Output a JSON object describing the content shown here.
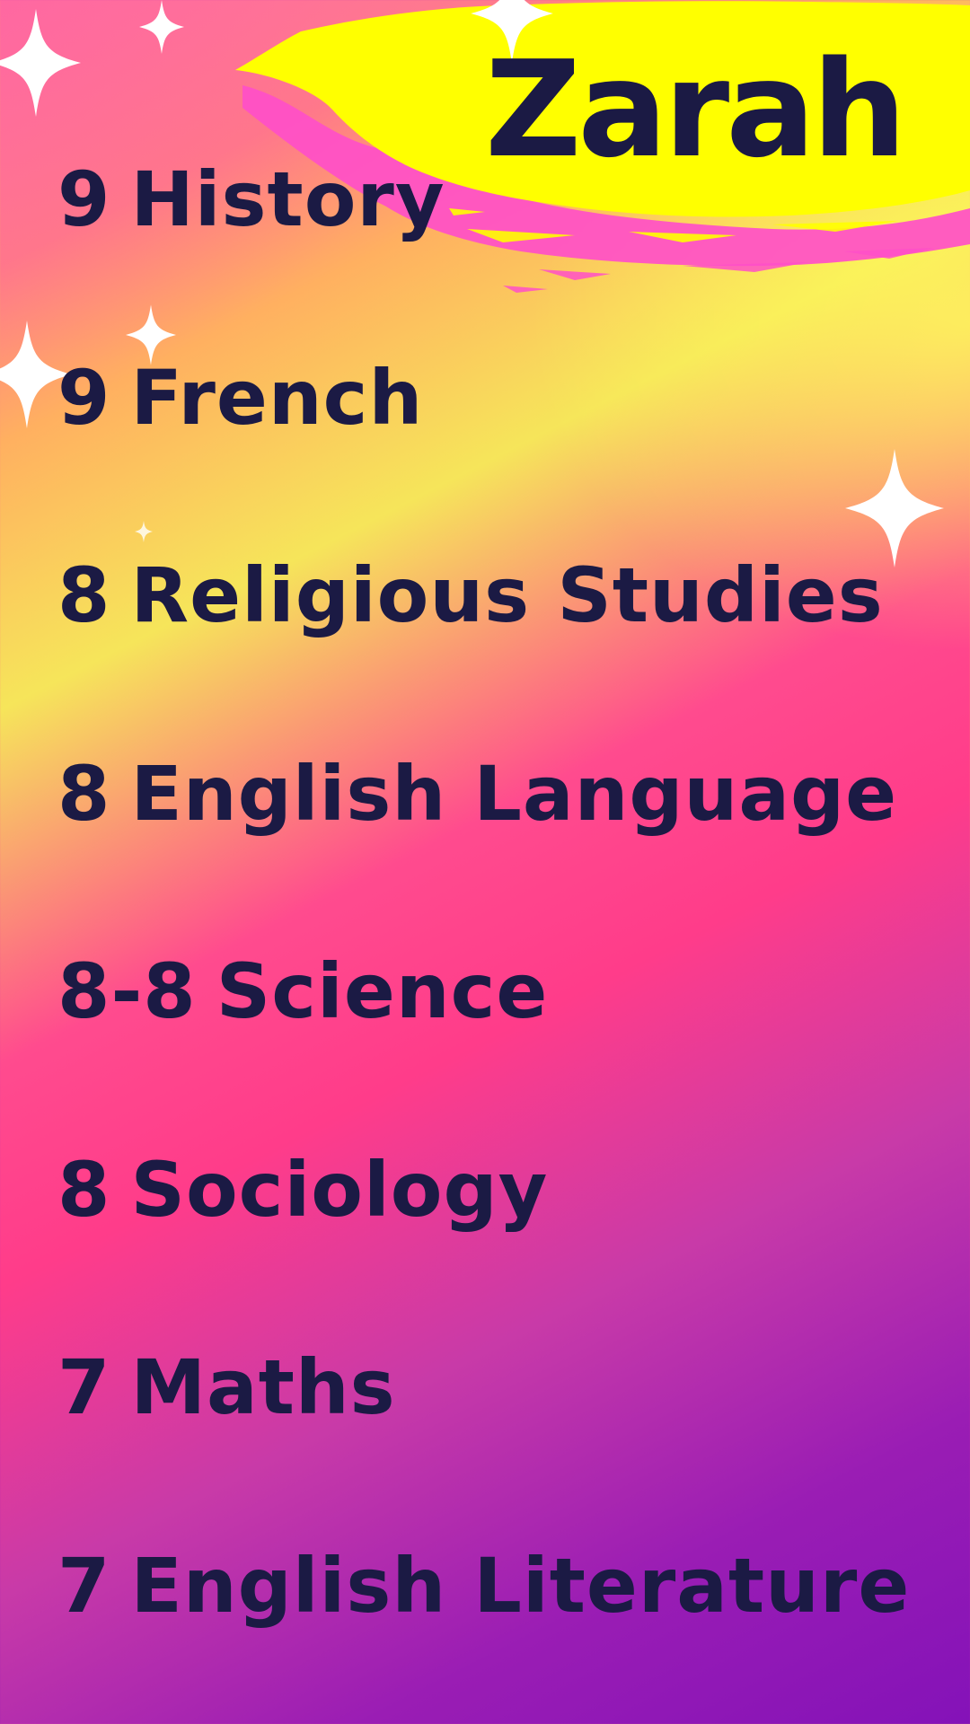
{
  "name": "Zarah",
  "grades": [
    {
      "grade": "9",
      "subject": "History"
    },
    {
      "grade": "9",
      "subject": "French"
    },
    {
      "grade": "8",
      "subject": "Religious Studies"
    },
    {
      "grade": "8",
      "subject": "English Language"
    },
    {
      "grade": "8-8",
      "subject": "Science"
    },
    {
      "grade": "8",
      "subject": "Sociology"
    },
    {
      "grade": "7",
      "subject": "Maths"
    },
    {
      "grade": "7",
      "subject": "English Literature"
    }
  ],
  "colors": {
    "text": "#1b1a44",
    "brush_yellow": "#ffff00",
    "brush_pink": "#ff4fc8",
    "sparkle": "#ffffff"
  },
  "icons": [
    "sparkle-icon"
  ]
}
